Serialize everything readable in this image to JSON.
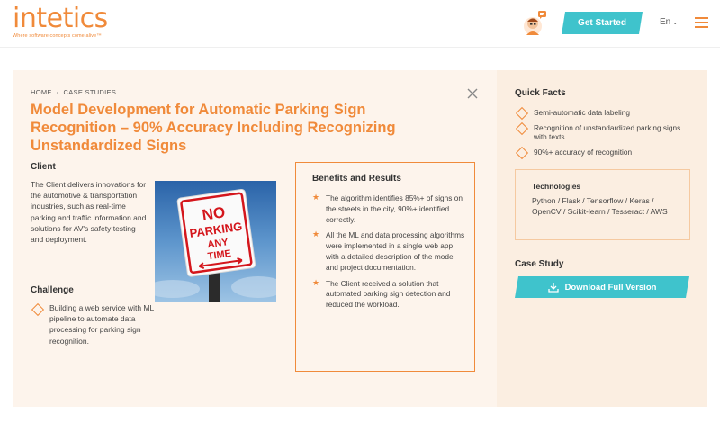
{
  "header": {
    "logo_text": "intetics",
    "logo_tagline": "Where software concepts come alive™",
    "cta_label": "Get Started",
    "language": "En"
  },
  "breadcrumb": {
    "home": "HOME",
    "section": "CASE STUDIES"
  },
  "title": "Model Development for Automatic Parking Sign Recognition – 90% Accuracy Including Recognizing Unstandardized Signs",
  "client": {
    "heading": "Client",
    "text": "The Client delivers innovations for the automotive & transportation industries, such as real-time parking and traffic information and solutions for AV's safety testing and deployment."
  },
  "sign": {
    "line1": "NO",
    "line2": "PARKING",
    "line3": "ANY",
    "line4": "TIME"
  },
  "challenge": {
    "heading": "Challenge",
    "items": [
      "Building a web service with ML pipeline to automate data processing for parking sign recognition."
    ]
  },
  "benefits": {
    "heading": "Benefits and Results",
    "items": [
      "The algorithm identifies 85%+ of signs on the streets in the city, 90%+ identified correctly.",
      "All the ML and data processing algorithms were implemented in a single web app with a detailed description of the model and project documentation.",
      "The Client received a solution that automated parking sign detection and reduced the workload."
    ]
  },
  "quick_facts": {
    "heading": "Quick Facts",
    "items": [
      "Semi-automatic data labeling",
      "Recognition of unstandardized parking signs with texts",
      "90%+ accuracy of recognition"
    ]
  },
  "technologies": {
    "heading": "Technologies",
    "text": "Python / Flask / Tensorflow / Keras / OpenCV / Scikit-learn / Tesseract / AWS"
  },
  "case_study": {
    "heading": "Case Study",
    "download_label": "Download Full Version"
  },
  "colors": {
    "accent": "#f08a3a",
    "teal": "#3fc3cc",
    "panel": "#fdf4ec",
    "side_panel": "#fbeee1"
  },
  "icons": [
    "avatar-icon",
    "chevron-down-icon",
    "hamburger-icon",
    "close-icon",
    "diamond-bullet-icon",
    "star-bullet-icon",
    "download-icon"
  ]
}
